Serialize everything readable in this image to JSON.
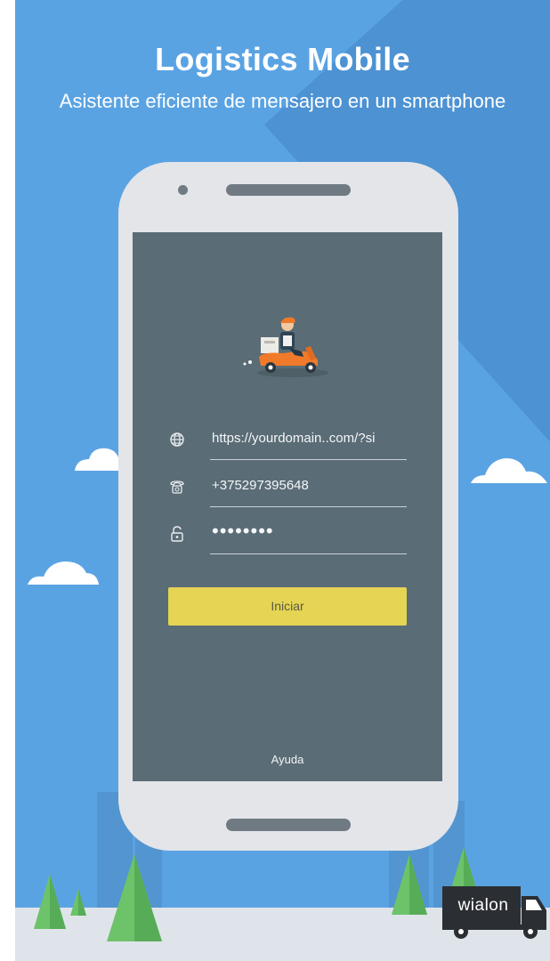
{
  "header": {
    "title": "Logistics Mobile",
    "subtitle": "Asistente eficiente de mensajero en un smartphone"
  },
  "login": {
    "server_url": "https://yourdomain..com/?si",
    "phone": "+375297395648",
    "password_mask": "••••••••",
    "submit_label": "Iniciar",
    "help_label": "Ayuda"
  },
  "branding": {
    "logo_text": "wialon"
  },
  "icons": {
    "server": "globe-icon",
    "phone": "telephone-icon",
    "password": "unlock-icon",
    "illustration": "courier-scooter-icon"
  },
  "colors": {
    "background": "#5aa3e3",
    "screen": "#5a6c76",
    "accent_button": "#e6d454",
    "phone_body": "#e3e5e9"
  }
}
